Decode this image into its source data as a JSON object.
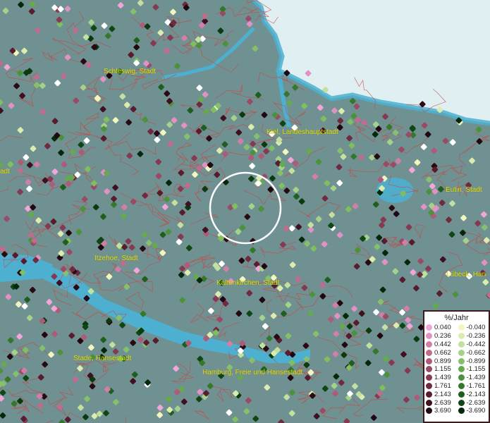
{
  "map": {
    "places": [
      {
        "name": "Schleswig, Stadt"
      },
      {
        "name": "Kiel, Landeshauptstadt"
      },
      {
        "name": "Eutin, Stadt"
      },
      {
        "name": "Itzehoe, Stadt"
      },
      {
        "name": "Kaltenkirchen, Stadt"
      },
      {
        "name": "Lübeck, Han"
      },
      {
        "name": "Stade, Hansestadt"
      },
      {
        "name": "Hamburg, Freie und Hansestadt"
      },
      {
        "name": "adt"
      }
    ],
    "colors": {
      "land": "#6f9191",
      "water": "#4db0d0",
      "sea": "#dfeff2",
      "borders": "#d04040",
      "label": "#e8e000"
    }
  },
  "legend": {
    "title": "%/Jahr",
    "rows": [
      {
        "pos": "0.040",
        "pos_color": "#f2a6d8",
        "neg": "-0.040",
        "neg_color": "#f4f6c0"
      },
      {
        "pos": "0.236",
        "pos_color": "#e291c4",
        "neg": "-0.236",
        "neg_color": "#dcecae"
      },
      {
        "pos": "0.442",
        "pos_color": "#d07fa8",
        "neg": "-0.442",
        "neg_color": "#c2e0a0"
      },
      {
        "pos": "0.662",
        "pos_color": "#bf6c8e",
        "neg": "-0.662",
        "neg_color": "#a4d28a"
      },
      {
        "pos": "0.899",
        "pos_color": "#ad5b78",
        "neg": "-0.899",
        "neg_color": "#86c06c"
      },
      {
        "pos": "1.155",
        "pos_color": "#9a4a64",
        "neg": "-1.155",
        "neg_color": "#66aa50"
      },
      {
        "pos": "1.439",
        "pos_color": "#853a52",
        "neg": "-1.439",
        "neg_color": "#4c923c"
      },
      {
        "pos": "1.761",
        "pos_color": "#6f2a40",
        "neg": "-1.761",
        "neg_color": "#34782c"
      },
      {
        "pos": "2.143",
        "pos_color": "#581c2e",
        "neg": "-2.143",
        "neg_color": "#1e5e1e"
      },
      {
        "pos": "2.639",
        "pos_color": "#3e1020",
        "neg": "-2.639",
        "neg_color": "#0f4614"
      },
      {
        "pos": "3.690",
        "pos_color": "#220610",
        "neg": "-3.690",
        "neg_color": "#06280a"
      }
    ]
  }
}
